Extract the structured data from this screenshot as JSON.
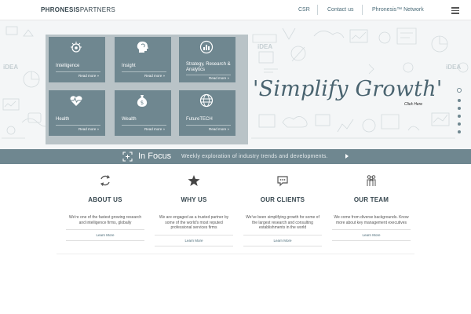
{
  "header": {
    "logo_bold": "PHRONESIS",
    "logo_light": "PARTNERS",
    "nav": [
      {
        "label": "CSR"
      },
      {
        "label": "Contact us"
      },
      {
        "label": "Phronesis™ Network"
      }
    ],
    "menu_icon": "hamburger-icon"
  },
  "hero": {
    "tiles": [
      {
        "label": "Intelligence",
        "more": "Read more »",
        "icon": "brain-gear-icon"
      },
      {
        "label": "Insight",
        "more": "Read more »",
        "icon": "head-profile-icon"
      },
      {
        "label": "Strategy, Research & Analytics",
        "more": "Read more »",
        "icon": "chart-badge-icon"
      },
      {
        "label": "Health",
        "more": "Read more »",
        "icon": "heart-pulse-icon"
      },
      {
        "label": "Wealth",
        "more": "Read more »",
        "icon": "money-bag-icon"
      },
      {
        "label": "FutureTECH",
        "more": "Read more »",
        "icon": "globe-network-icon"
      }
    ],
    "tagline": "'Simplify Growth'",
    "click_here": "Click Here",
    "slides_count": 6,
    "active_slide": 1,
    "doodle_text": "iDEA"
  },
  "focus": {
    "title": "In Focus",
    "text": "Weekly exploration of industry trends and developments.",
    "icon": "focus-target-icon",
    "arrow_icon": "play-arrow-icon"
  },
  "columns": [
    {
      "title": "ABOUT US",
      "text": "We're one of the fastest growing research and intelligence firms, globally",
      "link": "Learn More",
      "icon": "cycle-arrows-icon"
    },
    {
      "title": "WHY US",
      "text": "We are engaged as a trusted partner by some of the world's most reputed professional services firms",
      "link": "Learn More",
      "icon": "star-icon"
    },
    {
      "title": "OUR CLIENTS",
      "text": "We've been simplifying growth for some of the largest research and consulting establishments in the world",
      "link": "Learn More",
      "icon": "chat-bubble-icon"
    },
    {
      "title": "OUR TEAM",
      "text": "We come from diverse backgrounds. Know more about key management executives",
      "link": "Learn More",
      "icon": "team-people-icon"
    }
  ],
  "colors": {
    "accent": "#6f8790",
    "tile_panel": "#b9c3c7",
    "tagline": "#4a6470",
    "nav_text": "#4a6b78"
  }
}
